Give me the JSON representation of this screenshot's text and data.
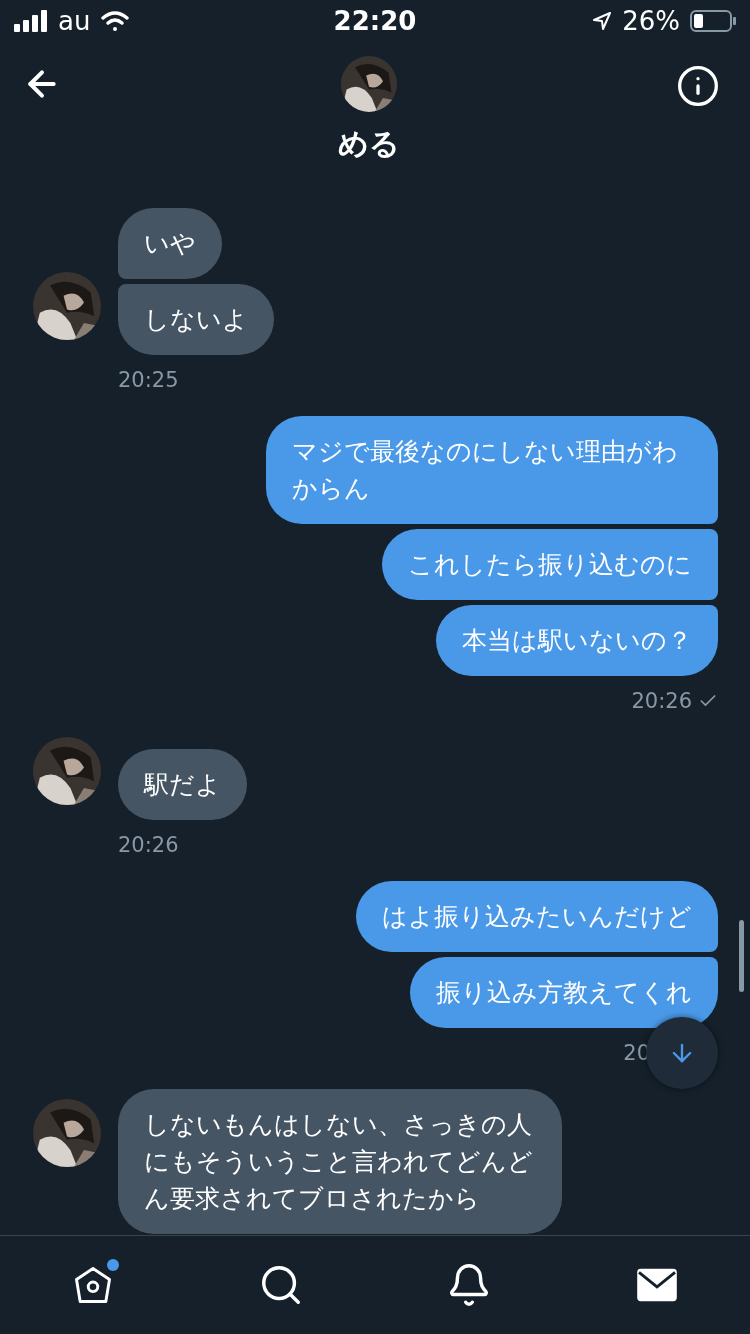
{
  "status_bar": {
    "carrier": "au",
    "time": "22:20",
    "battery": "26%"
  },
  "header": {
    "title": "める"
  },
  "messages": [
    {
      "kind": "incoming",
      "bubbles": [
        "いや",
        "しないよ"
      ],
      "time": "20:25",
      "read": false,
      "covered": false
    },
    {
      "kind": "outgoing",
      "bubbles": [
        "マジで最後なのにしない理由がわからん",
        "これしたら振り込むのに",
        "本当は駅いないの？"
      ],
      "time": "20:26",
      "read": true,
      "covered": false
    },
    {
      "kind": "incoming",
      "bubbles": [
        "駅だよ"
      ],
      "time": "20:26",
      "read": false,
      "covered": false
    },
    {
      "kind": "outgoing",
      "bubbles": [
        "はよ振り込みたいんだけど",
        "振り込み方教えてくれ"
      ],
      "time": "20",
      "read": false,
      "covered": true
    },
    {
      "kind": "incoming",
      "bubbles": [
        "しないもんはしない、さっきの人にもそういうこと言われてどんどん要求されてブロされたから"
      ]
    }
  ],
  "tab_bar": [
    {
      "kind": "home",
      "selected": false,
      "badge": true
    },
    {
      "kind": "search",
      "selected": false,
      "badge": false
    },
    {
      "kind": "bell",
      "selected": false,
      "badge": false
    },
    {
      "kind": "mail",
      "selected": true,
      "badge": false
    }
  ]
}
